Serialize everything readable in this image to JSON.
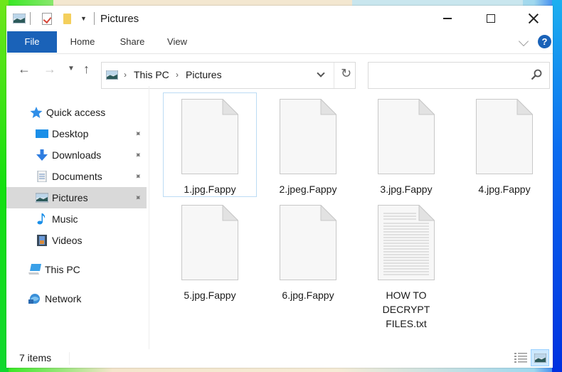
{
  "window": {
    "title": "Pictures",
    "controls": {
      "minimize": "minimize",
      "maximize": "maximize",
      "close": "close"
    }
  },
  "ribbon": {
    "tabs": [
      {
        "label": "File",
        "active": true
      },
      {
        "label": "Home"
      },
      {
        "label": "Share"
      },
      {
        "label": "View"
      }
    ],
    "help_label": "?"
  },
  "navbar": {
    "back": "←",
    "forward": "→",
    "recent": "⌄",
    "up": "↑",
    "breadcrumb": [
      "This PC",
      "Pictures"
    ],
    "crumb_separator": "›",
    "refresh": "↻",
    "search_placeholder": ""
  },
  "navpane": {
    "items": [
      {
        "label": "Quick access",
        "icon": "star-icon",
        "level": 0
      },
      {
        "label": "Desktop",
        "icon": "desktop-icon",
        "level": 1,
        "pinned": true
      },
      {
        "label": "Downloads",
        "icon": "download-icon",
        "level": 1,
        "pinned": true
      },
      {
        "label": "Documents",
        "icon": "documents-icon",
        "level": 1,
        "pinned": true
      },
      {
        "label": "Pictures",
        "icon": "pictures-icon",
        "level": 1,
        "pinned": true,
        "selected": true
      },
      {
        "label": "Music",
        "icon": "music-icon",
        "level": 1
      },
      {
        "label": "Videos",
        "icon": "videos-icon",
        "level": 1
      },
      {
        "label": "This PC",
        "icon": "computer-icon",
        "level": 0
      },
      {
        "label": "Network",
        "icon": "network-icon",
        "level": 0
      }
    ],
    "pin_glyph": "📌"
  },
  "files": [
    {
      "name": "1.jpg.Fappy",
      "type": "blank",
      "selected": true
    },
    {
      "name": "2.jpeg.Fappy",
      "type": "blank"
    },
    {
      "name": "3.jpg.Fappy",
      "type": "blank"
    },
    {
      "name": "4.jpg.Fappy",
      "type": "blank"
    },
    {
      "name": "5.jpg.Fappy",
      "type": "blank"
    },
    {
      "name": "6.jpg.Fappy",
      "type": "blank"
    },
    {
      "name": "HOW TO DECRYPT FILES.txt",
      "type": "text"
    }
  ],
  "statusbar": {
    "item_count": "7 items",
    "view_modes": [
      "details",
      "large-icons"
    ],
    "active_view": "large-icons"
  },
  "colors": {
    "accent": "#1a62b8",
    "selection": "#d9d9d9",
    "file_selection_border": "#bcdcf4"
  }
}
